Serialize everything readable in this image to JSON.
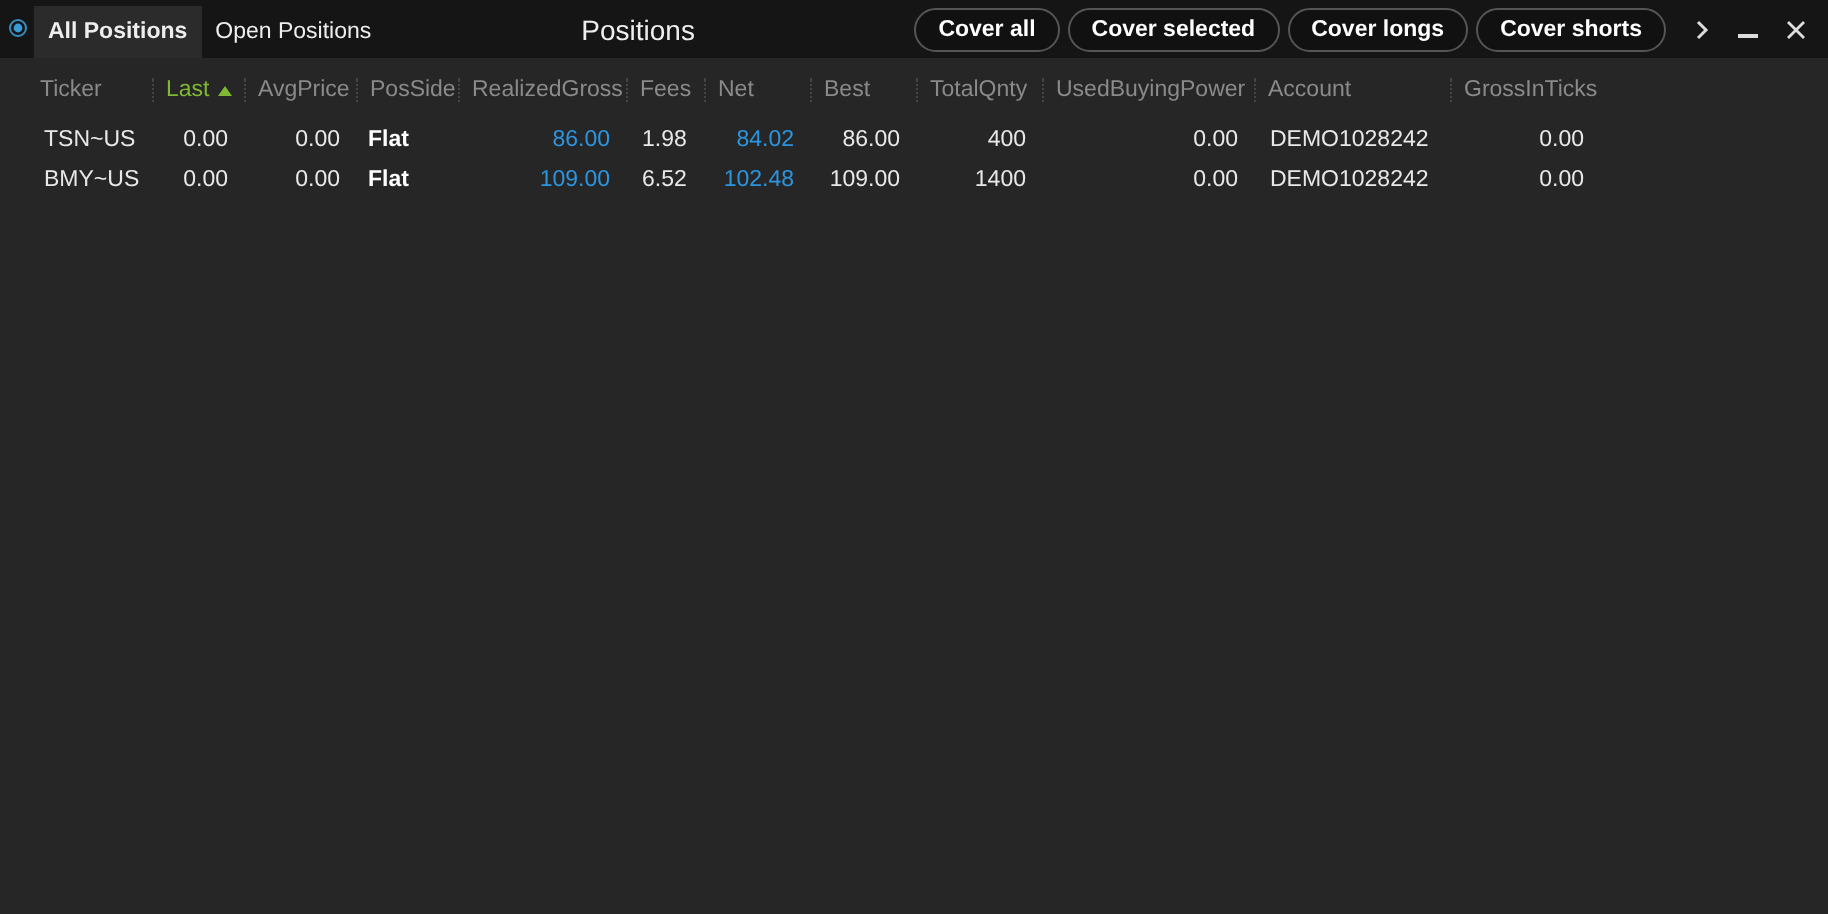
{
  "tabs": [
    {
      "label": "All Positions",
      "selected": true
    },
    {
      "label": "Open Positions",
      "selected": false
    }
  ],
  "title": "Positions",
  "buttons": [
    "Cover all",
    "Cover selected",
    "Cover longs",
    "Cover shorts"
  ],
  "table": {
    "columns": [
      {
        "label": "Ticker",
        "sorted": false,
        "kind": "text"
      },
      {
        "label": "Last",
        "sorted": true,
        "kind": "number"
      },
      {
        "label": "AvgPrice",
        "sorted": false,
        "kind": "number"
      },
      {
        "label": "PosSide",
        "sorted": false,
        "kind": "side"
      },
      {
        "label": "RealizedGross",
        "sorted": false,
        "kind": "pnl"
      },
      {
        "label": "Fees",
        "sorted": false,
        "kind": "text"
      },
      {
        "label": "Net",
        "sorted": false,
        "kind": "pnl"
      },
      {
        "label": "Best",
        "sorted": false,
        "kind": "number"
      },
      {
        "label": "TotalQnty",
        "sorted": false,
        "kind": "number"
      },
      {
        "label": "UsedBuyingPower",
        "sorted": false,
        "kind": "number"
      },
      {
        "label": "Account",
        "sorted": false,
        "kind": "text"
      },
      {
        "label": "GrossInTicks",
        "sorted": false,
        "kind": "number"
      }
    ],
    "rows": [
      [
        "TSN~US",
        "0.00",
        "0.00",
        "Flat",
        "86.00",
        "1.98",
        "84.02",
        "86.00",
        "400",
        "0.00",
        "DEMO1028242",
        "0.00"
      ],
      [
        "BMY~US",
        "0.00",
        "0.00",
        "Flat",
        "109.00",
        "6.52",
        "102.48",
        "109.00",
        "1400",
        "0.00",
        "DEMO1028242",
        "0.00"
      ]
    ]
  }
}
